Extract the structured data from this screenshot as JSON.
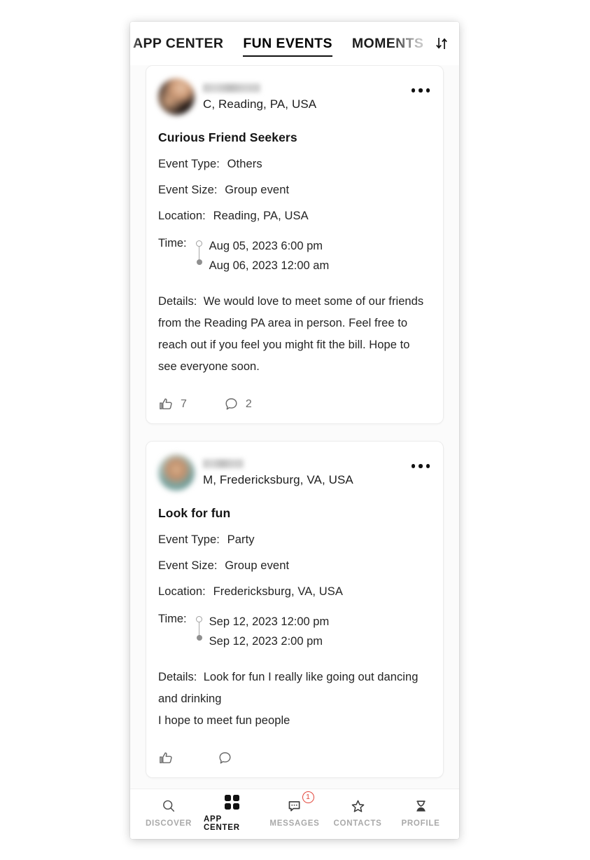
{
  "tabs": [
    {
      "label": "APP CENTER",
      "active": false,
      "clipped": true
    },
    {
      "label": "FUN EVENTS",
      "active": true,
      "clipped": false
    },
    {
      "label": "MOMENTS",
      "active": false,
      "clipped": false
    }
  ],
  "sort_icon": "sort-arrows-icon",
  "posts": [
    {
      "username": "",
      "handle": "C, Reading, PA, USA",
      "title": "Curious Friend Seekers",
      "event_type_label": "Event Type:",
      "event_type_value": "Others",
      "event_size_label": "Event Size:",
      "event_size_value": "Group event",
      "location_label": "Location:",
      "location_value": "Reading, PA, USA",
      "time_label": "Time:",
      "time_start": "Aug 05, 2023 6:00 pm",
      "time_end": "Aug 06, 2023 12:00 am",
      "details_label": "Details:",
      "details_text": "We would love to meet some of our friends from the Reading PA area in person. Feel free to reach out if you feel you might fit the bill. Hope to see everyone soon.",
      "details_extra": "",
      "like_count": "7",
      "comment_count": "2"
    },
    {
      "username": "",
      "handle": "M, Fredericksburg, VA, USA",
      "title": "Look for fun",
      "event_type_label": "Event Type:",
      "event_type_value": "Party",
      "event_size_label": "Event Size:",
      "event_size_value": "Group event",
      "location_label": "Location:",
      "location_value": "Fredericksburg, VA, USA",
      "time_label": "Time:",
      "time_start": "Sep 12, 2023 12:00 pm",
      "time_end": "Sep 12, 2023 2:00 pm",
      "details_label": "Details:",
      "details_text": "Look for fun I really like going out dancing and drinking",
      "details_extra": "I hope to meet fun people",
      "like_count": "",
      "comment_count": ""
    }
  ],
  "bottom_nav": [
    {
      "label": "DISCOVER",
      "icon": "search-icon",
      "active": false,
      "badge": ""
    },
    {
      "label": "APP CENTER",
      "icon": "grid-icon",
      "active": true,
      "badge": ""
    },
    {
      "label": "MESSAGES",
      "icon": "chat-icon",
      "active": false,
      "badge": "1"
    },
    {
      "label": "CONTACTS",
      "icon": "star-icon",
      "active": false,
      "badge": ""
    },
    {
      "label": "PROFILE",
      "icon": "person-icon",
      "active": false,
      "badge": ""
    }
  ],
  "colors": {
    "accent": "#e2473c",
    "text": "#242424",
    "muted": "#a9a9a9"
  }
}
